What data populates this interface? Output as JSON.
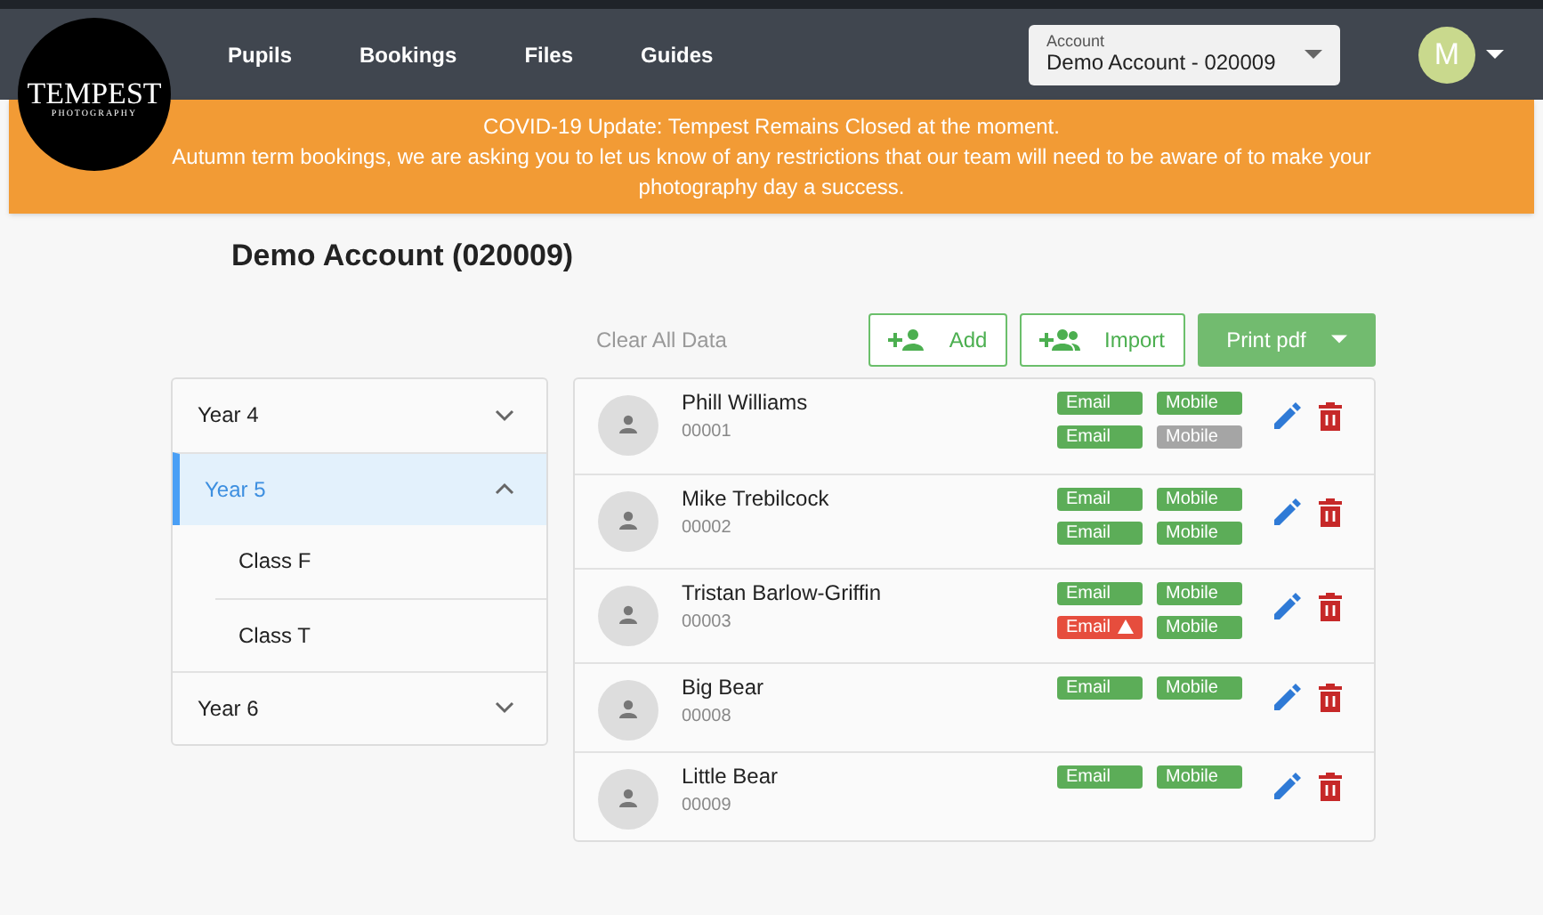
{
  "logo": {
    "name": "TEMPEST",
    "tagline": "PHOTOGRAPHY"
  },
  "nav": [
    {
      "label": "Pupils"
    },
    {
      "label": "Bookings"
    },
    {
      "label": "Files"
    },
    {
      "label": "Guides"
    }
  ],
  "account": {
    "label": "Account",
    "value": "Demo Account - 020009"
  },
  "user": {
    "initial": "M"
  },
  "banner": {
    "lines": [
      "COVID-19 Update: Tempest Remains Closed at the moment.",
      "Autumn term bookings, we are asking you to let us know of any restrictions that our team will need to be aware of to make your photography day a success."
    ]
  },
  "page_title": "Demo Account (020009)",
  "toolbar": {
    "clear": "Clear All Data",
    "add": "Add",
    "import": "Import",
    "print": "Print pdf"
  },
  "years": [
    {
      "label": "Year 4",
      "selected": false,
      "expanded": false
    },
    {
      "label": "Year 5",
      "selected": true,
      "expanded": true,
      "children": [
        {
          "label": "Class F"
        },
        {
          "label": "Class T"
        }
      ]
    },
    {
      "label": "Year 6",
      "selected": false,
      "expanded": false
    }
  ],
  "pupils": [
    {
      "name": "Phill Williams",
      "id": "00001",
      "tags": [
        [
          {
            "label": "Email",
            "color": "#5cad58",
            "warning": false
          },
          {
            "label": "Mobile",
            "color": "#5cad58",
            "warning": false
          }
        ],
        [
          {
            "label": "Email",
            "color": "#5cad58",
            "warning": false
          },
          {
            "label": "Mobile",
            "color": "#a5a5a5",
            "warning": false
          }
        ]
      ]
    },
    {
      "name": "Mike Trebilcock",
      "id": "00002",
      "tags": [
        [
          {
            "label": "Email",
            "color": "#5cad58",
            "warning": false
          },
          {
            "label": "Mobile",
            "color": "#5cad58",
            "warning": false
          }
        ],
        [
          {
            "label": "Email",
            "color": "#5cad58",
            "warning": false
          },
          {
            "label": "Mobile",
            "color": "#5cad58",
            "warning": false
          }
        ]
      ]
    },
    {
      "name": "Tristan Barlow-Griffin",
      "id": "00003",
      "tags": [
        [
          {
            "label": "Email",
            "color": "#5cad58",
            "warning": false
          },
          {
            "label": "Mobile",
            "color": "#5cad58",
            "warning": false
          }
        ],
        [
          {
            "label": "Email",
            "color": "#e64d3d",
            "warning": true
          },
          {
            "label": "Mobile",
            "color": "#5cad58",
            "warning": false
          }
        ]
      ]
    },
    {
      "name": "Big Bear",
      "id": "00008",
      "tags": [
        [
          {
            "label": "Email",
            "color": "#5cad58",
            "warning": false
          },
          {
            "label": "Mobile",
            "color": "#5cad58",
            "warning": false
          }
        ]
      ]
    },
    {
      "name": "Little Bear",
      "id": "00009",
      "tags": [
        [
          {
            "label": "Email",
            "color": "#5cad58",
            "warning": false
          },
          {
            "label": "Mobile",
            "color": "#5cad58",
            "warning": false
          }
        ]
      ]
    }
  ]
}
